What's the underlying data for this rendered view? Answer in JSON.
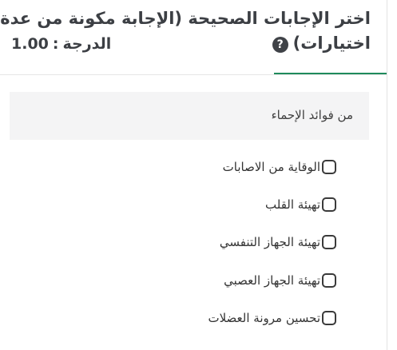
{
  "question": {
    "title": "اختر الإجابات الصحيحة (الإجابة مكونة من عدة اختيارات)",
    "help_icon": "question-circle-icon",
    "grade_label": "الدرجة",
    "grade_separator": ":",
    "grade_value": "1.00"
  },
  "prompt": "من فوائد الإحماء",
  "options": [
    {
      "label": "الوقاية من الاصابات",
      "checked": false
    },
    {
      "label": "تهيئة القلب",
      "checked": false
    },
    {
      "label": "تهيئة الجهاز التنفسي",
      "checked": false
    },
    {
      "label": "تهيئة الجهاز العصبي",
      "checked": false
    },
    {
      "label": "تحسين مرونة العضلات",
      "checked": false
    }
  ],
  "colors": {
    "accent": "#1f8a5c",
    "prompt_background": "#f4f4f5",
    "title_text": "#3c3f44"
  }
}
